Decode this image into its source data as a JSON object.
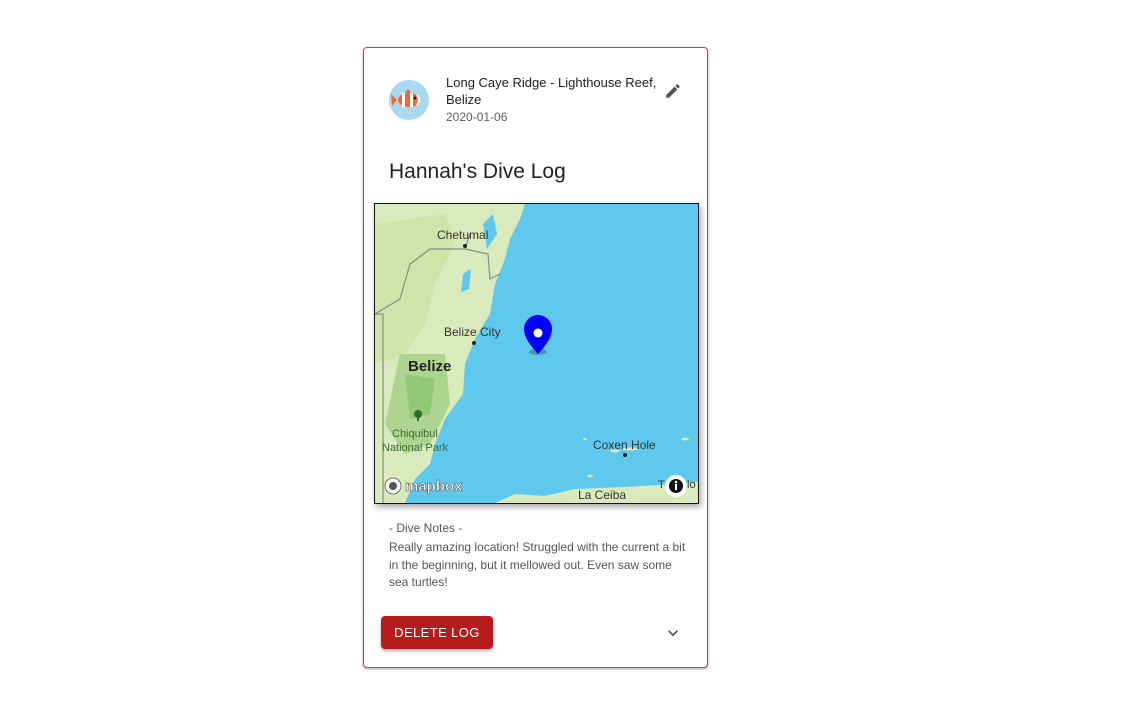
{
  "card": {
    "location": "Long Caye Ridge - Lighthouse Reef, Belize",
    "date": "2020-01-06",
    "title": "Hannah's Dive Log",
    "avatar_icon": "clownfish-icon",
    "edit_icon": "pencil-icon"
  },
  "map": {
    "labels": {
      "chetumal": "Chetumal",
      "belize_city": "Belize City",
      "belize": "Belize",
      "chiquibul_1": "Chiquibul",
      "chiquibul_2": "National Park",
      "coxen_hole": "Coxen Hole",
      "la_ceiba": "La Ceiba",
      "truncated": "T",
      "truncated_end": "lo",
      "brand": "mapbox"
    },
    "marker_icon": "map-pin-icon",
    "water_color": "#5ec9ec",
    "land_color": "#d9eabc",
    "marker_color": "#0000ff"
  },
  "notes": {
    "heading": "- Dive Notes -",
    "body": "Really amazing location! Struggled with the current a bit in the beginning, but it mellowed out. Even saw some sea turtles!"
  },
  "actions": {
    "delete_label": "DELETE LOG",
    "expand_icon": "chevron-down-icon"
  },
  "colors": {
    "accent": "#b71c1c",
    "card_border": "#d83a3a"
  }
}
